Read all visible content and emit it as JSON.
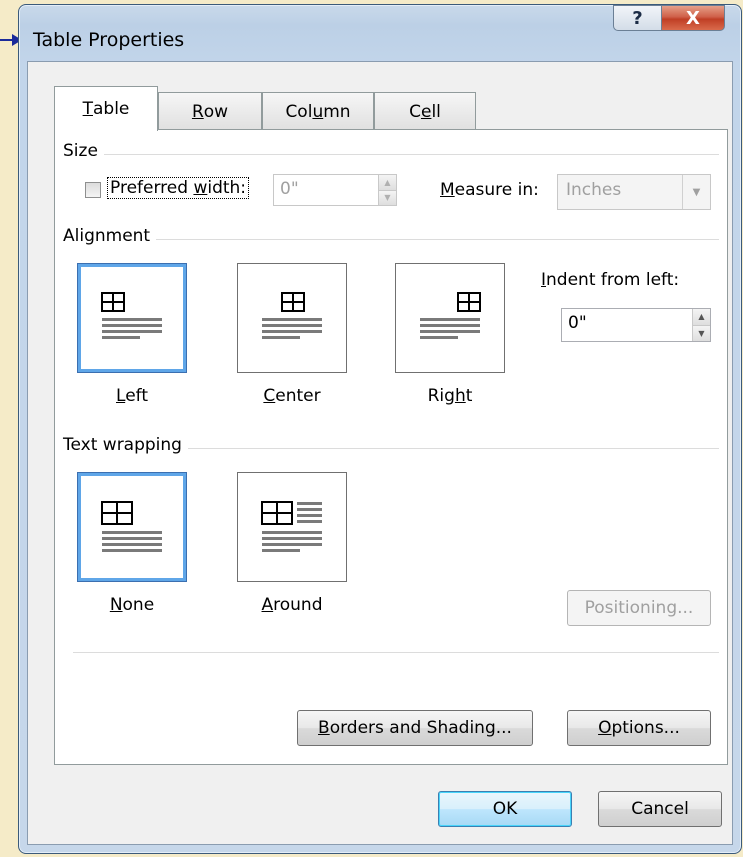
{
  "window": {
    "title": "Table Properties",
    "help_label": "?",
    "close_label": "X"
  },
  "tabs": [
    {
      "pre": "",
      "key": "T",
      "post": "able"
    },
    {
      "pre": "",
      "key": "R",
      "post": "ow"
    },
    {
      "pre": "Col",
      "key": "u",
      "post": "mn"
    },
    {
      "pre": "C",
      "key": "e",
      "post": "ll"
    }
  ],
  "size": {
    "group": "Size",
    "preferred_width": {
      "pre": "Preferred ",
      "key": "w",
      "post": "idth:",
      "checked": false,
      "value": "0\""
    },
    "measure_in": {
      "key": "M",
      "post": "easure in:",
      "value": "Inches"
    }
  },
  "alignment": {
    "group": "Alignment",
    "options": [
      {
        "pre": "",
        "key": "L",
        "post": "eft",
        "selected": true
      },
      {
        "pre": "",
        "key": "C",
        "post": "enter",
        "selected": false
      },
      {
        "pre": "Rig",
        "key": "h",
        "post": "t",
        "selected": false
      }
    ],
    "indent_label": {
      "key": "I",
      "post": "ndent from left:"
    },
    "indent_value": "0\""
  },
  "text_wrapping": {
    "group": "Text wrapping",
    "options": [
      {
        "pre": "",
        "key": "N",
        "post": "one",
        "selected": true
      },
      {
        "pre": "",
        "key": "A",
        "post": "round",
        "selected": false
      }
    ],
    "positioning": "Positioning..."
  },
  "buttons": {
    "borders": {
      "key": "B",
      "post": "orders and Shading..."
    },
    "options": {
      "key": "O",
      "post": "ptions..."
    },
    "ok": "OK",
    "cancel": "Cancel"
  }
}
